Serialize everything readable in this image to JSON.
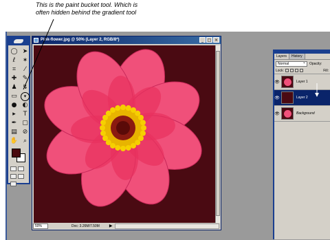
{
  "caption": {
    "line1": "This is the paint bucket tool. Which is",
    "line2": "often hidden behind the gradient tool"
  },
  "toolbox": {
    "tools": [
      {
        "icon": "marquee-icon",
        "glyph": "◯"
      },
      {
        "icon": "move-icon",
        "glyph": "➤"
      },
      {
        "icon": "lasso-icon",
        "glyph": "ℓ"
      },
      {
        "icon": "magic-wand-icon",
        "glyph": "✶"
      },
      {
        "icon": "crop-icon",
        "glyph": "⌗"
      },
      {
        "icon": "slice-icon",
        "glyph": "⁄"
      },
      {
        "icon": "healing-brush-icon",
        "glyph": "✚"
      },
      {
        "icon": "brush-icon",
        "glyph": "✎"
      },
      {
        "icon": "clone-stamp-icon",
        "glyph": "♟"
      },
      {
        "icon": "history-brush-icon",
        "glyph": "↯"
      },
      {
        "icon": "eraser-icon",
        "glyph": "▭"
      },
      {
        "icon": "paint-bucket-icon",
        "glyph": "▾"
      },
      {
        "icon": "blur-icon",
        "glyph": "●"
      },
      {
        "icon": "dodge-icon",
        "glyph": "◐"
      },
      {
        "icon": "path-selection-icon",
        "glyph": "▸"
      },
      {
        "icon": "type-icon",
        "glyph": "T"
      },
      {
        "icon": "pen-icon",
        "glyph": "✒"
      },
      {
        "icon": "shape-icon",
        "glyph": "▢"
      },
      {
        "icon": "notes-icon",
        "glyph": "▤"
      },
      {
        "icon": "eyedropper-icon",
        "glyph": "⊘"
      },
      {
        "icon": "hand-icon",
        "glyph": "✋"
      },
      {
        "icon": "zoom-icon",
        "glyph": "⌕"
      }
    ],
    "foreground_color": "#4a0a0f",
    "background_color": "#ffffff"
  },
  "document": {
    "title": "Pink-flower.jpg @ 50% (Layer 2, RGB/8*)",
    "zoom": "50%",
    "doc_size": "Doc: 3.26M/7.50M",
    "canvas_color": "#4a0a12"
  },
  "layers_panel": {
    "tabs": [
      "Layers",
      "History"
    ],
    "blend_mode": "Normal",
    "opacity_label": "Opacity:",
    "lock_label": "Lock:",
    "fill_label": "Fill:",
    "layers": [
      {
        "name": "Layer 1",
        "selected": false
      },
      {
        "name": "Layer 2",
        "selected": true
      },
      {
        "name": "Background",
        "selected": false
      }
    ]
  },
  "colors": {
    "titlebar": "#0a246a",
    "panel": "#d4d0c8",
    "workspace": "#9a9a9a",
    "petal": "#f0507a",
    "flower_center": "#e8b400"
  }
}
